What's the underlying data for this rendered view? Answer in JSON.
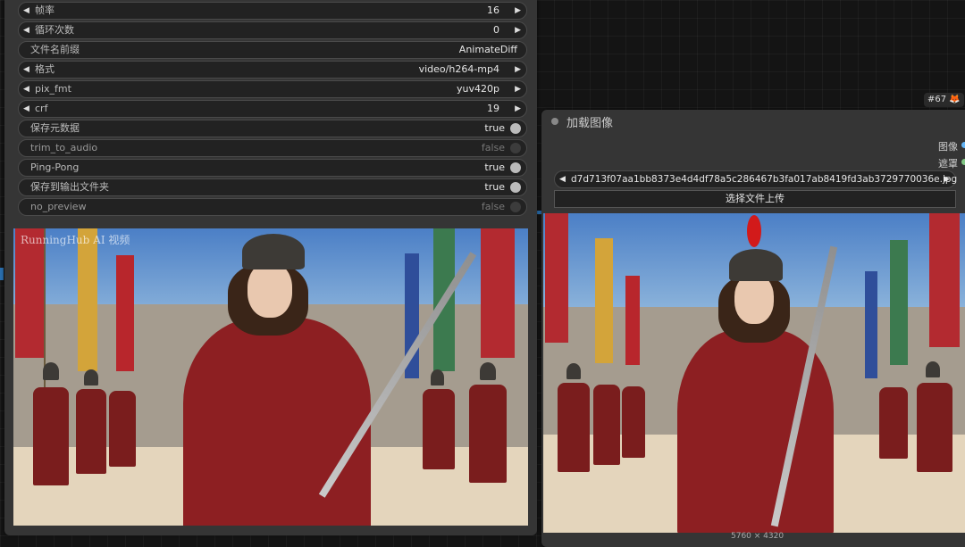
{
  "left_node": {
    "widgets": [
      {
        "label": "帧率",
        "value": "16",
        "kind": "number"
      },
      {
        "label": "循环次数",
        "value": "0",
        "kind": "number"
      },
      {
        "label": "文件名前缀",
        "value": "AnimateDiff",
        "kind": "text"
      },
      {
        "label": "格式",
        "value": "video/h264-mp4",
        "kind": "combo"
      },
      {
        "label": "pix_fmt",
        "value": "yuv420p",
        "kind": "combo"
      },
      {
        "label": "crf",
        "value": "19",
        "kind": "number"
      },
      {
        "label": "保存元数据",
        "value": "true",
        "kind": "toggle_on"
      },
      {
        "label": "trim_to_audio",
        "value": "false",
        "kind": "toggle_off"
      },
      {
        "label": "Ping-Pong",
        "value": "true",
        "kind": "toggle_on"
      },
      {
        "label": "保存到输出文件夹",
        "value": "true",
        "kind": "toggle_on"
      },
      {
        "label": "no_preview",
        "value": "false",
        "kind": "toggle_off"
      }
    ],
    "preview_watermark": "RunningHub AI 视频"
  },
  "right_node": {
    "title": "加载图像",
    "outputs": [
      {
        "label": "图像",
        "color": "#64b5f6"
      },
      {
        "label": "遮罩",
        "color": "#81c784"
      }
    ],
    "file_value": "d7d713f07aa1bb8373e4d4df78a5c286467b3fa017ab8419fd3ab3729770036e.jpg",
    "upload_label": "选择文件上传",
    "dimensions": "5760 × 4320"
  },
  "node_badge": "#67 🦊",
  "icons": {
    "left_arrow": "◀",
    "right_arrow": "▶"
  }
}
